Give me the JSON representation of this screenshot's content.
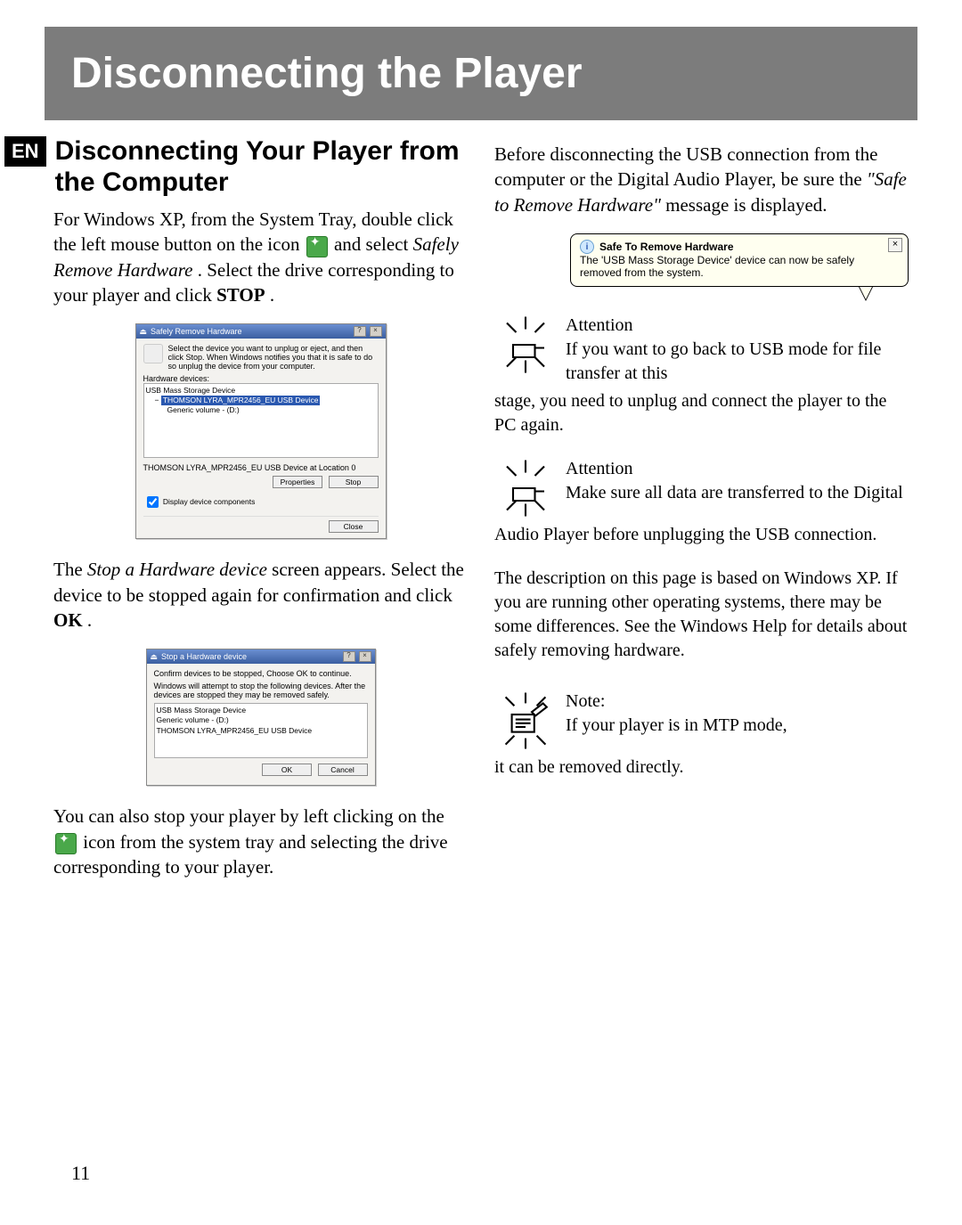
{
  "page": {
    "title": "Disconnecting the Player",
    "lang_tag": "EN",
    "subheading": "Disconnecting Your Player from the Computer",
    "pageNumber": "11"
  },
  "left": {
    "p1_a": "For Windows XP, from the System Tray, double click the left mouse button on the icon ",
    "p1_b": " and select ",
    "p1_italic1": "Safely Remove Hardware",
    "p1_c": ". Select the drive corresponding to your player and click ",
    "p1_bold": "STOP",
    "p1_d": ".",
    "p2_a": "The ",
    "p2_italic": "Stop a Hardware device",
    "p2_b": " screen appears. Select the device to be stopped again for confirmation and click ",
    "p2_bold": "OK",
    "p2_c": ".",
    "p3_a": "You can also stop your player by left clicking on the ",
    "p3_b": " icon from the system tray and selecting the drive corresponding to your player."
  },
  "dialog1": {
    "title": "Safely Remove Hardware",
    "instruction": "Select the device you want to unplug or eject, and then click Stop. When Windows notifies you that it is safe to do so unplug the device from your computer.",
    "hwLabel": "Hardware devices:",
    "devices": {
      "root": "USB Mass Storage Device",
      "child1": "THOMSON LYRA_MPR2456_EU USB Device",
      "child2": "Generic volume - (D:)"
    },
    "location": "THOMSON LYRA_MPR2456_EU USB Device at Location 0",
    "btnProperties": "Properties",
    "btnStop": "Stop",
    "checkbox": "Display device components",
    "btnClose": "Close"
  },
  "dialog2": {
    "title": "Stop a Hardware device",
    "line1": "Confirm devices to be stopped, Choose OK to continue.",
    "line2": "Windows will attempt to stop the following devices. After the devices are stopped they may be removed safely.",
    "devices": {
      "d1": "USB Mass Storage Device",
      "d2": "Generic volume - (D:)",
      "d3": "THOMSON LYRA_MPR2456_EU USB Device"
    },
    "btnOK": "OK",
    "btnCancel": "Cancel"
  },
  "right": {
    "p1_a": "Before disconnecting the USB connection from the computer or the  Digital Audio Player, be sure the ",
    "p1_italic": "\"Safe to Remove Hardware\"",
    "p1_b": " message is displayed."
  },
  "balloon": {
    "title": "Safe To Remove Hardware",
    "body": "The 'USB Mass Storage Device' device can now be safely removed from the system."
  },
  "callout1": {
    "title": "Attention",
    "lead": "If you want to go back to USB mode for file transfer at this ",
    "rest": "stage, you need to unplug and connect the player to the PC again."
  },
  "callout2": {
    "title": "Attention",
    "lead": "Make sure all data are transferred to the Digital ",
    "rest": "Audio Player before unplugging the USB connection."
  },
  "osNote": "The description on this page is based on Windows XP. If you are running other operating systems, there may be some differences. See the Windows Help for details about safely removing hardware.",
  "callout3": {
    "title": "Note:",
    "lead": "If your player is in MTP mode, ",
    "rest": "it can be removed directly."
  }
}
